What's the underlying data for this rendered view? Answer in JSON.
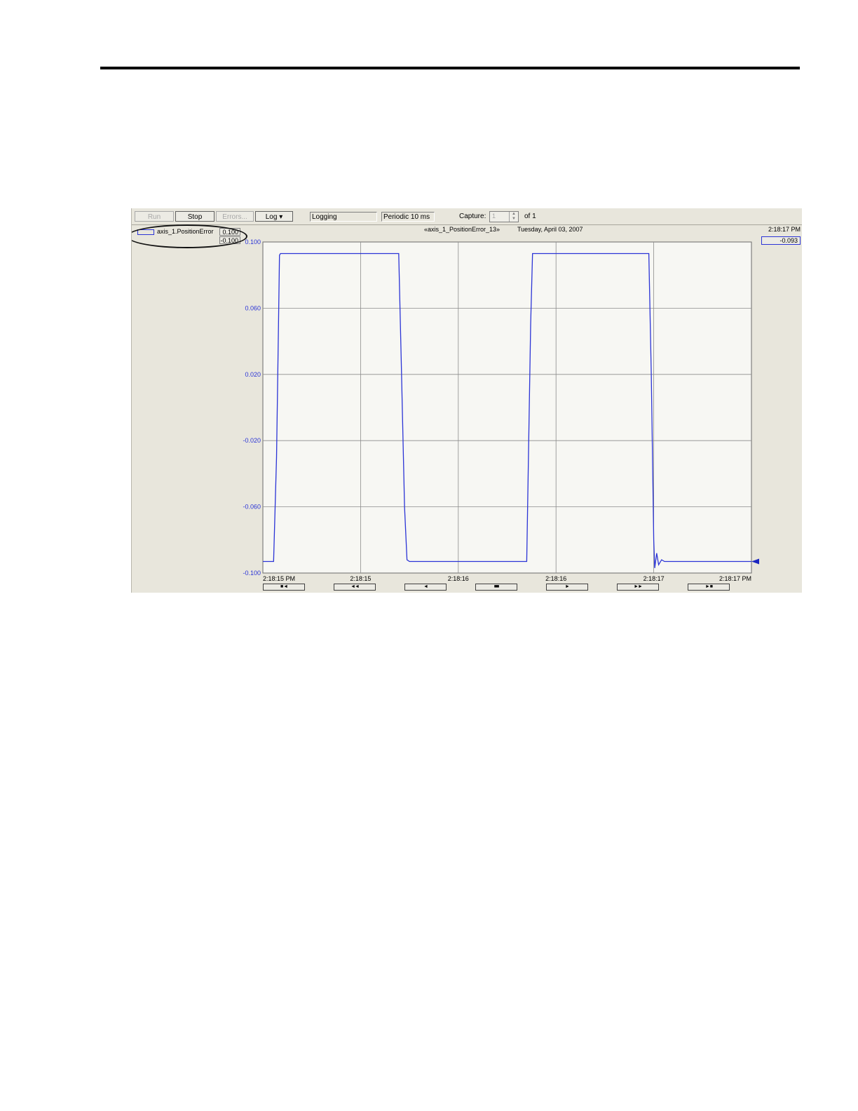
{
  "toolbar": {
    "run_label": "Run",
    "stop_label": "Stop",
    "errors_label": "Errors...",
    "log_label": "Log ▾",
    "status_field": "Logging",
    "sample_period": "Periodic 10 ms",
    "capture_label": "Capture:",
    "capture_value": "1",
    "capture_of": "of 1"
  },
  "legend": {
    "pen_name": "axis_1.PositionError",
    "pen_max": "0.100",
    "pen_min": "-0.100",
    "pen_color": "#2b34d6"
  },
  "header": {
    "trend_name": "«axis_1_PositionError_13»",
    "date": "Tuesday, April 03, 2007",
    "time_end": "2:18:17 PM",
    "cursor_value": "-0.093"
  },
  "icons": {
    "legend_swatch": "pen-color-swatch",
    "cursor_marker": "value-cursor-arrow-icon",
    "spin": "spin-arrows-icon"
  },
  "nav_buttons": [
    {
      "name": "nav-first-button",
      "icon": "first-icon",
      "glyph": "■ ◄"
    },
    {
      "name": "nav-fast-back-button",
      "icon": "fast-back-icon",
      "glyph": "◄◄"
    },
    {
      "name": "nav-back-button",
      "icon": "back-icon",
      "glyph": "◄"
    },
    {
      "name": "nav-pause-button",
      "icon": "pause-icon",
      "glyph": "■■"
    },
    {
      "name": "nav-forward-button",
      "icon": "forward-icon",
      "glyph": "►"
    },
    {
      "name": "nav-fast-forward-button",
      "icon": "fast-forward-icon",
      "glyph": "►►"
    },
    {
      "name": "nav-last-button",
      "icon": "last-icon",
      "glyph": "► ■"
    }
  ],
  "chart_data": {
    "type": "line",
    "title": "«axis_1_PositionError_13»",
    "xlabel": "",
    "ylabel": "",
    "ylim": [
      -0.1,
      0.1
    ],
    "y_tick_labels": [
      "0.100",
      "0.060",
      "0.020",
      "-0.020",
      "-0.060",
      "-0.100"
    ],
    "x_tick_labels": [
      "2:18:15 PM",
      "2:18:15",
      "2:18:16",
      "2:18:16",
      "2:18:17",
      "2:18:17 PM"
    ],
    "xlim": [
      0,
      100
    ],
    "grid": true,
    "series": [
      {
        "name": "axis_1.PositionError",
        "color": "#2b34d6",
        "x": [
          0,
          2.2,
          2.8,
          3.2,
          3.4,
          3.6,
          27.8,
          28.3,
          29.0,
          29.5,
          30.0,
          30.4,
          53.5,
          54.0,
          54.8,
          55.2,
          55.6,
          79.0,
          79.5,
          80.0,
          80.2,
          80.6,
          81.0,
          81.6,
          82.2,
          100
        ],
        "y": [
          -0.093,
          -0.093,
          -0.03,
          0.05,
          0.092,
          0.093,
          0.093,
          0.03,
          -0.06,
          -0.092,
          -0.093,
          -0.093,
          -0.093,
          -0.093,
          0.05,
          0.093,
          0.093,
          0.093,
          0.02,
          -0.08,
          -0.097,
          -0.088,
          -0.095,
          -0.092,
          -0.093,
          -0.093
        ]
      }
    ]
  }
}
